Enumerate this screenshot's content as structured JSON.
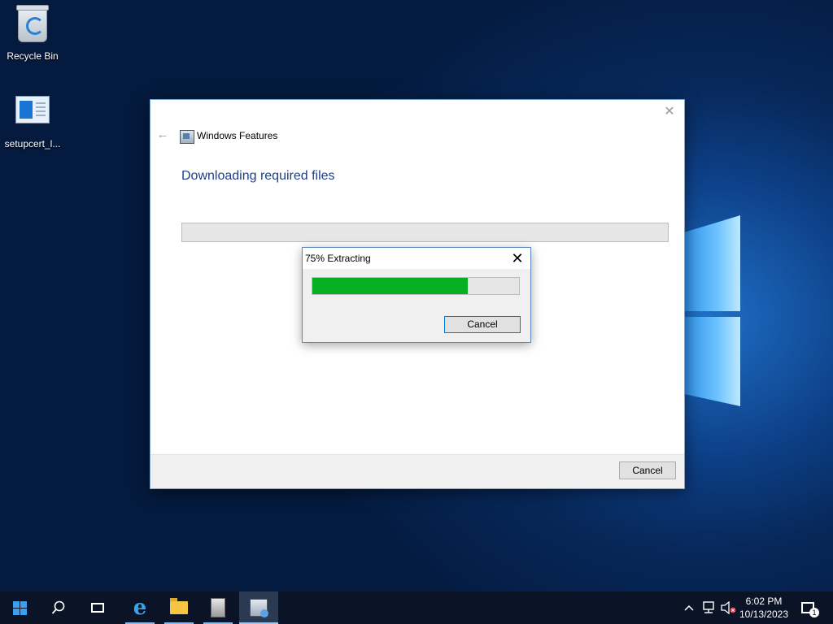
{
  "desktop": {
    "icons": [
      {
        "label": "Recycle Bin"
      },
      {
        "label": "setupcert_l..."
      }
    ]
  },
  "features_window": {
    "title": "Windows Features",
    "heading": "Downloading required files",
    "cancel_label": "Cancel",
    "close_symbol": "✕",
    "back_symbol": "←"
  },
  "extract_dialog": {
    "title": "75% Extracting",
    "progress_fraction": 0.75,
    "progress_color": "#06b025",
    "cancel_label": "Cancel",
    "close_symbol": "✕"
  },
  "taskbar": {
    "items": [
      {
        "icon": "windows-start-icon"
      },
      {
        "icon": "search-icon"
      },
      {
        "icon": "task-view-icon"
      },
      {
        "icon": "internet-explorer-icon"
      },
      {
        "icon": "file-explorer-icon"
      },
      {
        "icon": "server-manager-icon"
      },
      {
        "icon": "windows-features-icon"
      }
    ],
    "tray": {
      "chevron": "⌃",
      "time": "6:02 PM",
      "date": "10/13/2023",
      "notification_count": "1"
    }
  }
}
